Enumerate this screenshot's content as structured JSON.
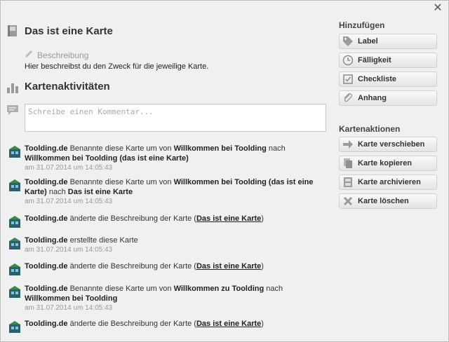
{
  "window": {
    "close_glyph": "✕"
  },
  "card": {
    "title": "Das ist eine Karte",
    "description_label": "Beschreibung",
    "description_text": "Hier beschreibst du den Zweck für die jeweilige Karte.",
    "activities_title": "Kartenaktivitäten",
    "comment_placeholder": "Schreibe einen Kommentar..."
  },
  "activities": [
    {
      "user": "Toolding.de",
      "t1": " Benannte diese Karte um von ",
      "b1": "Willkommen bei Toolding",
      "t2": " nach ",
      "b2": "Willkommen bei Toolding (das ist eine Karte)",
      "date": "am 31.07.2014 um 14:05:43"
    },
    {
      "user": "Toolding.de",
      "t1": " Benannte diese Karte um von ",
      "b1": "Willkommen bei Toolding (das ist eine Karte)",
      "t2": " nach ",
      "b2": "Das ist eine Karte",
      "date": "am 31.07.2014 um 14:05:43"
    },
    {
      "user": "Toolding.de",
      "t1": " änderte die Beschreibung der Karte (",
      "link": "Das ist eine Karte",
      "t2": ")"
    },
    {
      "user": "Toolding.de",
      "t1": " erstellte diese Karte",
      "date": "am 31.07.2014 um 14:05:43"
    },
    {
      "user": "Toolding.de",
      "t1": " änderte die Beschreibung der Karte (",
      "link": "Das ist eine Karte",
      "t2": ")"
    },
    {
      "user": "Toolding.de",
      "t1": " Benannte diese Karte um von ",
      "b1": "Willkommen zu Toolding",
      "t2": " nach ",
      "b2": "Willkommen bei Toolding",
      "date": "am 31.07.2014 um 14:05:43"
    },
    {
      "user": "Toolding.de",
      "t1": " änderte die Beschreibung der Karte (",
      "link": "Das ist eine Karte",
      "t2": ")"
    }
  ],
  "sidebar": {
    "add_heading": "Hinzufügen",
    "add_buttons": [
      {
        "label": "Label",
        "icon": "tag-icon"
      },
      {
        "label": "Fälligkeit",
        "icon": "clock-icon"
      },
      {
        "label": "Checkliste",
        "icon": "checklist-icon"
      },
      {
        "label": "Anhang",
        "icon": "paperclip-icon"
      }
    ],
    "actions_heading": "Kartenaktionen",
    "action_buttons": [
      {
        "label": "Karte verschieben",
        "icon": "arrow-right-icon"
      },
      {
        "label": "Karte kopieren",
        "icon": "copy-icon"
      },
      {
        "label": "Karte archivieren",
        "icon": "archive-icon"
      },
      {
        "label": "Karte löschen",
        "icon": "delete-icon"
      }
    ]
  },
  "colors": {
    "background": "#f0f0f0",
    "button_border": "#cfcfcf",
    "muted_text": "#999999"
  }
}
